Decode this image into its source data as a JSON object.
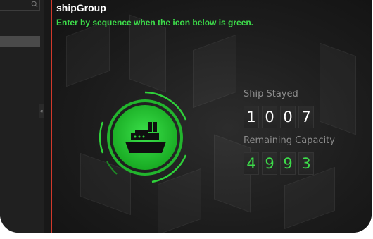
{
  "header": {
    "title": "shipGroup",
    "instruction": "Enter by sequence when the icon below is green."
  },
  "sidebar": {
    "collapse_glyph": "«",
    "search_icon": "search-icon"
  },
  "indicator": {
    "icon": "ship-icon",
    "status_color": "#2fd13a"
  },
  "stats": {
    "stayed": {
      "label": "Ship Stayed",
      "digits": [
        "1",
        "0",
        "0",
        "7"
      ]
    },
    "remaining": {
      "label": "Remaining Capacity",
      "digits": [
        "4",
        "9",
        "9",
        "3"
      ]
    }
  },
  "colors": {
    "accent_green": "#3ddc4a",
    "divider_red": "#d0392b",
    "background": "#181818"
  }
}
